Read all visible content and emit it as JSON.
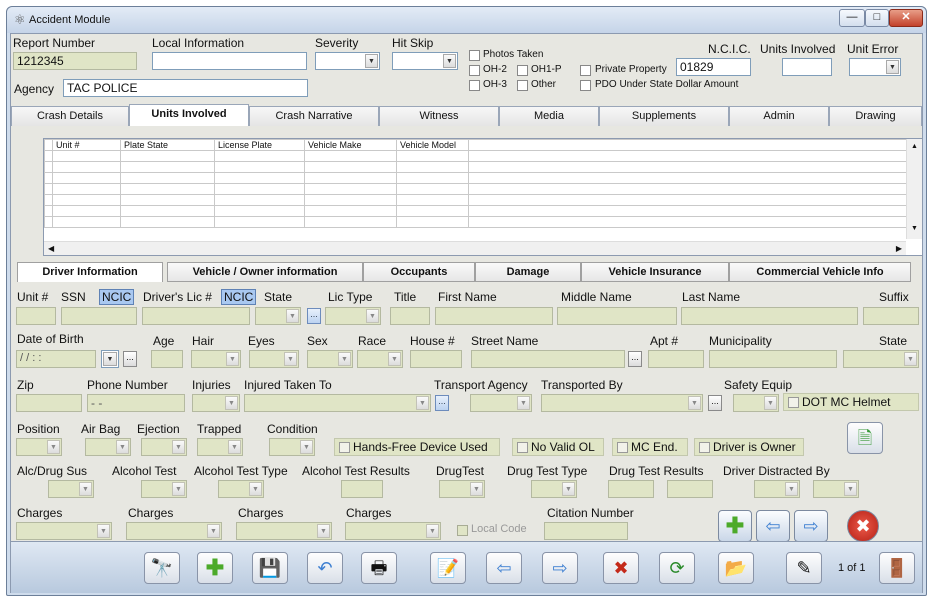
{
  "window": {
    "title": "Accident Module"
  },
  "header": {
    "report_number_label": "Report Number",
    "report_number": "1212345",
    "local_information_label": "Local Information",
    "severity_label": "Severity",
    "hit_skip_label": "Hit Skip",
    "photos_taken": "Photos Taken",
    "oh2": "OH-2",
    "oh1p": "OH1-P",
    "oh3": "OH-3",
    "other": "Other",
    "private_property": "Private Property",
    "pdo": "PDO Under State Dollar Amount",
    "ncic_label": "N.C.I.C.",
    "ncic_value": "01829",
    "units_involved_label": "Units Involved",
    "unit_error_label": "Unit Error",
    "agency_label": "Agency",
    "agency_value": "TAC POLICE"
  },
  "main_tabs": [
    "Crash Details",
    "Units Involved",
    "Crash Narrative",
    "Witness",
    "Media",
    "Supplements",
    "Admin",
    "Drawing"
  ],
  "units_grid": {
    "columns": [
      "Unit #",
      "Plate State",
      "License Plate",
      "Vehicle Make",
      "Vehicle Model"
    ]
  },
  "sub_tabs": [
    "Driver Information",
    "Vehicle / Owner information",
    "Occupants",
    "Damage",
    "Vehicle Insurance",
    "Commercial Vehicle Info"
  ],
  "driver": {
    "unit": "Unit #",
    "ssn": "SSN",
    "ncic": "NCIC",
    "drivers_lic": "Driver's Lic #",
    "ncic2": "NCIC",
    "state": "State",
    "lic_type": "Lic Type",
    "title": "Title",
    "first_name": "First Name",
    "middle_name": "Middle Name",
    "last_name": "Last Name",
    "suffix": "Suffix",
    "dob": "Date of Birth",
    "dob_value": "/ /      : :",
    "age": "Age",
    "hair": "Hair",
    "eyes": "Eyes",
    "sex": "Sex",
    "race": "Race",
    "house": "House #",
    "street": "Street Name",
    "apt": "Apt #",
    "municipality": "Municipality",
    "state2": "State",
    "zip": "Zip",
    "phone": "Phone Number",
    "phone_value": "-  -",
    "injuries": "Injuries",
    "injured_taken_to": "Injured Taken To",
    "transport_agency": "Transport Agency",
    "transported_by": "Transported By",
    "safety_equip": "Safety Equip",
    "dot_helmet": "DOT MC Helmet",
    "position": "Position",
    "air_bag": "Air Bag",
    "ejection": "Ejection",
    "trapped": "Trapped",
    "condition": "Condition",
    "hands_free": "Hands-Free Device Used",
    "no_valid_ol": "No Valid OL",
    "mc_end": "MC End.",
    "driver_is_owner": "Driver is Owner",
    "alc_drug_sus": "Alc/Drug Sus",
    "alcohol_test": "Alcohol Test",
    "alcohol_test_type": "Alcohol Test Type",
    "alcohol_test_results": "Alcohol Test Results",
    "drug_test": "DrugTest",
    "drug_test_type": "Drug Test Type",
    "drug_test_results": "Drug Test Results",
    "driver_distracted_by": "Driver Distracted By",
    "charges": "Charges",
    "local_code": "Local Code",
    "citation_number": "Citation Number"
  },
  "pager": "1 of 1"
}
